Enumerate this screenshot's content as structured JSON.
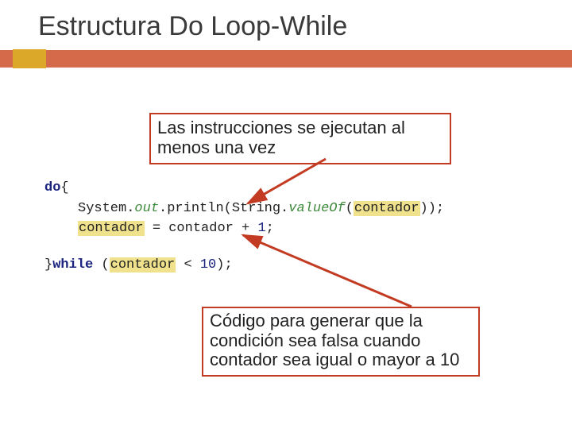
{
  "title": "Estructura Do Loop-While",
  "callout1": "Las instrucciones se ejecutan al menos una vez",
  "callout2": "Código para generar que la condición sea falsa cuando contador sea igual o mayor a 10",
  "code": {
    "l1_kw": "do",
    "l1_brace": "{",
    "l2a": "System.",
    "l2b": "out",
    "l2c": ".println(String.",
    "l2d": "valueOf",
    "l2e": "(",
    "l2f": "contador",
    "l2g": "));",
    "l3a": "contador",
    "l3b": " = contador + ",
    "l3c": "1",
    "l3d": ";",
    "l4a": "}",
    "l4b": "while",
    "l4c": " (",
    "l4d": "contador",
    "l4e": " < ",
    "l4f": "10",
    "l4g": ");"
  }
}
